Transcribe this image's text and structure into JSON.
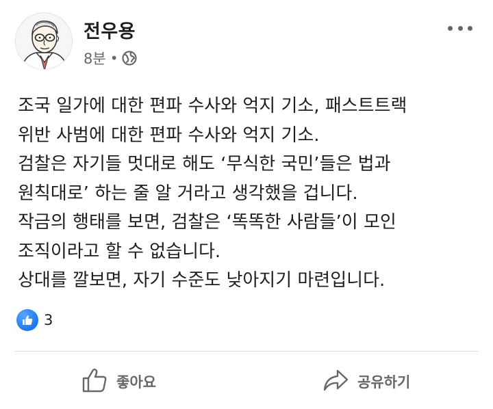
{
  "author": {
    "name": "전우용"
  },
  "meta": {
    "time": "8분",
    "separator": "•",
    "privacy_icon": "globe-icon"
  },
  "post": {
    "lines": [
      "조국 일가에 대한 편파 수사와 억지 기소, 패스트트랙",
      "위반 사범에 대한 편파 수사와 억지 기소.",
      "검찰은 자기들 멋대로 해도 ‘무식한 국민’들은 법과",
      "원칙대로’ 하는 줄 알 거라고 생각했을 겁니다.",
      "작금의 행태를 보면, 검찰은 ‘똑똑한 사람들’이 모인",
      "조직이라고 할 수 없습니다.",
      "상대를 깔보면, 자기 수준도 낮아지기 마련입니다."
    ]
  },
  "reactions": {
    "icon": "like-reaction-icon",
    "count": "3",
    "color": "#1877f2"
  },
  "actions": {
    "like_label": "좋아요",
    "share_label": "공유하기"
  },
  "colors": {
    "text": "#1c1e21",
    "secondary": "#65676b",
    "divider": "#dadde1"
  }
}
